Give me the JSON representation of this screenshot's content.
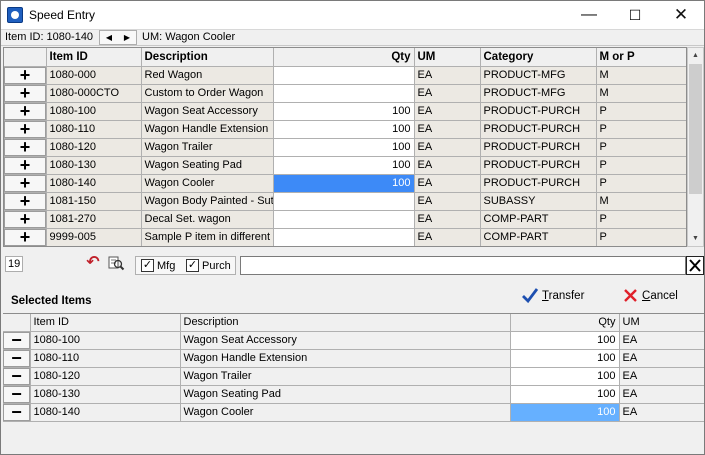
{
  "window": {
    "title": "Speed Entry",
    "min_glyph": "—",
    "max_glyph": "☐",
    "close_glyph": "✕",
    "icon": "app-icon"
  },
  "infobar": {
    "item_id_text": "Item ID: 1080-140",
    "um_text": "UM: Wagon Cooler",
    "prev_glyph": "◀",
    "next_glyph": "▶"
  },
  "grid": {
    "headers": [
      "",
      "Item ID",
      "Description",
      "Qty",
      "UM",
      "Category",
      "M or P"
    ],
    "add_glyph": "+",
    "rows": [
      {
        "item_id": "1080-000",
        "description": "Red Wagon",
        "qty": "",
        "um": "EA",
        "category": "PRODUCT-MFG",
        "morp": "M"
      },
      {
        "item_id": "1080-000CTO",
        "description": "Custom to Order Wagon",
        "qty": "",
        "um": "EA",
        "category": "PRODUCT-MFG",
        "morp": "M"
      },
      {
        "item_id": "1080-100",
        "description": "Wagon Seat Accessory",
        "qty": "100",
        "um": "EA",
        "category": "PRODUCT-PURCH",
        "morp": "P"
      },
      {
        "item_id": "1080-110",
        "description": "Wagon Handle Extension",
        "qty": "100",
        "um": "EA",
        "category": "PRODUCT-PURCH",
        "morp": "P"
      },
      {
        "item_id": "1080-120",
        "description": "Wagon Trailer",
        "qty": "100",
        "um": "EA",
        "category": "PRODUCT-PURCH",
        "morp": "P"
      },
      {
        "item_id": "1080-130",
        "description": "Wagon Seating Pad",
        "qty": "100",
        "um": "EA",
        "category": "PRODUCT-PURCH",
        "morp": "P"
      },
      {
        "item_id": "1080-140",
        "description": "Wagon Cooler",
        "qty": "100",
        "um": "EA",
        "category": "PRODUCT-PURCH",
        "morp": "P"
      },
      {
        "item_id": "1081-150",
        "description": "Wagon Body Painted -  Sut",
        "qty": "",
        "um": "EA",
        "category": "SUBASSY",
        "morp": "M"
      },
      {
        "item_id": "1081-270",
        "description": "Decal Set. wagon",
        "qty": "",
        "um": "EA",
        "category": "COMP-PART",
        "morp": "P"
      },
      {
        "item_id": "9999-005",
        "description": "Sample P item in different U",
        "qty": "",
        "um": "EA",
        "category": "COMP-PART",
        "morp": "P"
      }
    ]
  },
  "toolbar": {
    "count": "19",
    "filter_mfg": "Mfg",
    "filter_purch": "Purch",
    "search_value": "",
    "check_glyph": "✓",
    "undo_glyph": "↶",
    "clear_glyph": "✕",
    "undo_icon": "undo-icon",
    "find_icon": "find-items-icon"
  },
  "selected": {
    "title": "Selected Items",
    "transfer_label_u": "T",
    "transfer_label_rest": "ransfer",
    "cancel_label_u": "C",
    "cancel_label_rest": "ancel",
    "headers": [
      "",
      "Item ID",
      "Description",
      "Qty",
      "UM"
    ],
    "remove_glyph": "−",
    "rows": [
      {
        "item_id": "1080-100",
        "description": "Wagon Seat Accessory",
        "qty": "100",
        "um": "EA"
      },
      {
        "item_id": "1080-110",
        "description": "Wagon Handle Extension",
        "qty": "100",
        "um": "EA"
      },
      {
        "item_id": "1080-120",
        "description": "Wagon Trailer",
        "qty": "100",
        "um": "EA"
      },
      {
        "item_id": "1080-130",
        "description": "Wagon Seating Pad",
        "qty": "100",
        "um": "EA"
      },
      {
        "item_id": "1080-140",
        "description": "Wagon Cooler",
        "qty": "100",
        "um": "EA"
      }
    ]
  },
  "colors": {
    "selection": "#3d8af7",
    "selection_light": "#66b0ff",
    "transfer_check": "#1d4fb0",
    "cancel_x": "#e0202a",
    "undo": "#c0202a"
  }
}
